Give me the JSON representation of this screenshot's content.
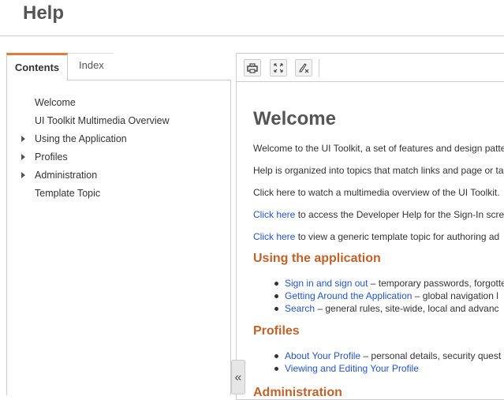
{
  "header": {
    "title": "Help"
  },
  "nav": {
    "tabs": [
      "Contents",
      "Index"
    ],
    "items": [
      {
        "label": "Welcome",
        "expandable": false
      },
      {
        "label": "UI Toolkit Multimedia Overview",
        "expandable": false
      },
      {
        "label": "Using the Application",
        "expandable": true
      },
      {
        "label": "Profiles",
        "expandable": true
      },
      {
        "label": "Administration",
        "expandable": true
      },
      {
        "label": "Template Topic",
        "expandable": false
      }
    ],
    "collapse_glyph": "«"
  },
  "toolbar": {
    "icons": [
      "print-icon",
      "expand-icon",
      "clear-highlight-icon"
    ]
  },
  "content": {
    "title": "Welcome",
    "paragraphs": [
      {
        "text": "Welcome to the UI Toolkit, a set of features and design patte"
      },
      {
        "text": "Help is organized into topics that match links and page or ta"
      },
      {
        "text": "Click here to watch a multimedia overview of the UI Toolkit."
      },
      {
        "link": "Click here",
        "text": " to access the Developer Help for the Sign-In scre"
      },
      {
        "link": "Click here",
        "text": " to view a generic template topic for authoring ad"
      }
    ],
    "sections": [
      {
        "heading": "Using the application",
        "bullets": [
          {
            "link": "Sign in and sign out",
            "text": " – temporary passwords, forgotte"
          },
          {
            "link": "Getting Around the Application",
            "text": " – global navigation l"
          },
          {
            "link": "Search",
            "text": " – general rules, site-wide, local and advanc"
          }
        ]
      },
      {
        "heading": "Profiles",
        "bullets": [
          {
            "link": "About Your Profile",
            "text": " – personal details, security quest"
          },
          {
            "link": "Viewing and Editing Your Profile",
            "text": ""
          }
        ]
      },
      {
        "heading": "Administration",
        "bullets": []
      }
    ]
  },
  "colors": {
    "accent_tab": "#e07b3a",
    "section_heading": "#c0622a",
    "link": "#2255cc"
  }
}
